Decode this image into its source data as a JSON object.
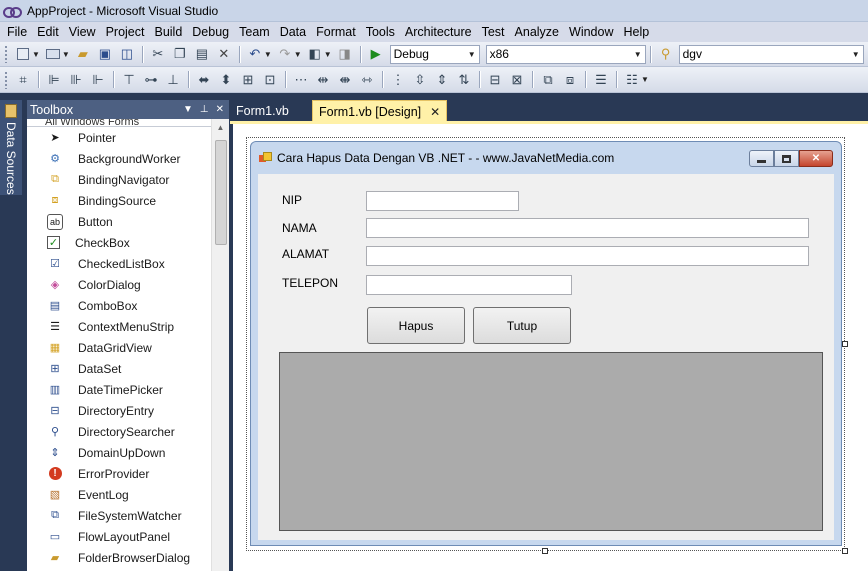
{
  "window": {
    "title": "AppProject - Microsoft Visual Studio"
  },
  "menu": [
    "File",
    "Edit",
    "View",
    "Project",
    "Build",
    "Debug",
    "Team",
    "Data",
    "Format",
    "Tools",
    "Architecture",
    "Test",
    "Analyze",
    "Window",
    "Help"
  ],
  "toolbar": {
    "config_value": "Debug",
    "platform_value": "x86",
    "find_value": "dgv"
  },
  "side_panel": {
    "label": "Data Sources"
  },
  "toolbox": {
    "title": "Toolbox",
    "group": "All Windows Forms",
    "items": [
      {
        "label": "Pointer",
        "icon": "pointer-icon"
      },
      {
        "label": "BackgroundWorker",
        "icon": "backgroundworker-icon"
      },
      {
        "label": "BindingNavigator",
        "icon": "bindingnavigator-icon"
      },
      {
        "label": "BindingSource",
        "icon": "bindingsource-icon"
      },
      {
        "label": "Button",
        "icon": "button-icon"
      },
      {
        "label": "CheckBox",
        "icon": "checkbox-icon"
      },
      {
        "label": "CheckedListBox",
        "icon": "checkedlistbox-icon"
      },
      {
        "label": "ColorDialog",
        "icon": "colordialog-icon"
      },
      {
        "label": "ComboBox",
        "icon": "combobox-icon"
      },
      {
        "label": "ContextMenuStrip",
        "icon": "contextmenustrip-icon"
      },
      {
        "label": "DataGridView",
        "icon": "datagridview-icon"
      },
      {
        "label": "DataSet",
        "icon": "dataset-icon"
      },
      {
        "label": "DateTimePicker",
        "icon": "datetimepicker-icon"
      },
      {
        "label": "DirectoryEntry",
        "icon": "directoryentry-icon"
      },
      {
        "label": "DirectorySearcher",
        "icon": "directorysearcher-icon"
      },
      {
        "label": "DomainUpDown",
        "icon": "domainupdown-icon"
      },
      {
        "label": "ErrorProvider",
        "icon": "errorprovider-icon"
      },
      {
        "label": "EventLog",
        "icon": "eventlog-icon"
      },
      {
        "label": "FileSystemWatcher",
        "icon": "filesystemwatcher-icon"
      },
      {
        "label": "FlowLayoutPanel",
        "icon": "flowlayoutpanel-icon"
      },
      {
        "label": "FolderBrowserDialog",
        "icon": "folderbrowserdialog-icon"
      }
    ]
  },
  "tabs": [
    {
      "label": "Form1.vb",
      "active": false
    },
    {
      "label": "Form1.vb [Design]",
      "active": true
    }
  ],
  "form": {
    "title": "Cara Hapus Data Dengan VB .NET - - www.JavaNetMedia.com",
    "labels": {
      "nip": "NIP",
      "nama": "NAMA",
      "alamat": "ALAMAT",
      "telepon": "TELEPON"
    },
    "buttons": {
      "hapus": "Hapus",
      "tutup": "Tutup"
    }
  },
  "colors": {
    "ide_background": "#293955",
    "tab_active": "#fff1a8",
    "toolbox_header": "#4d6082",
    "grid_background": "#ababab"
  }
}
